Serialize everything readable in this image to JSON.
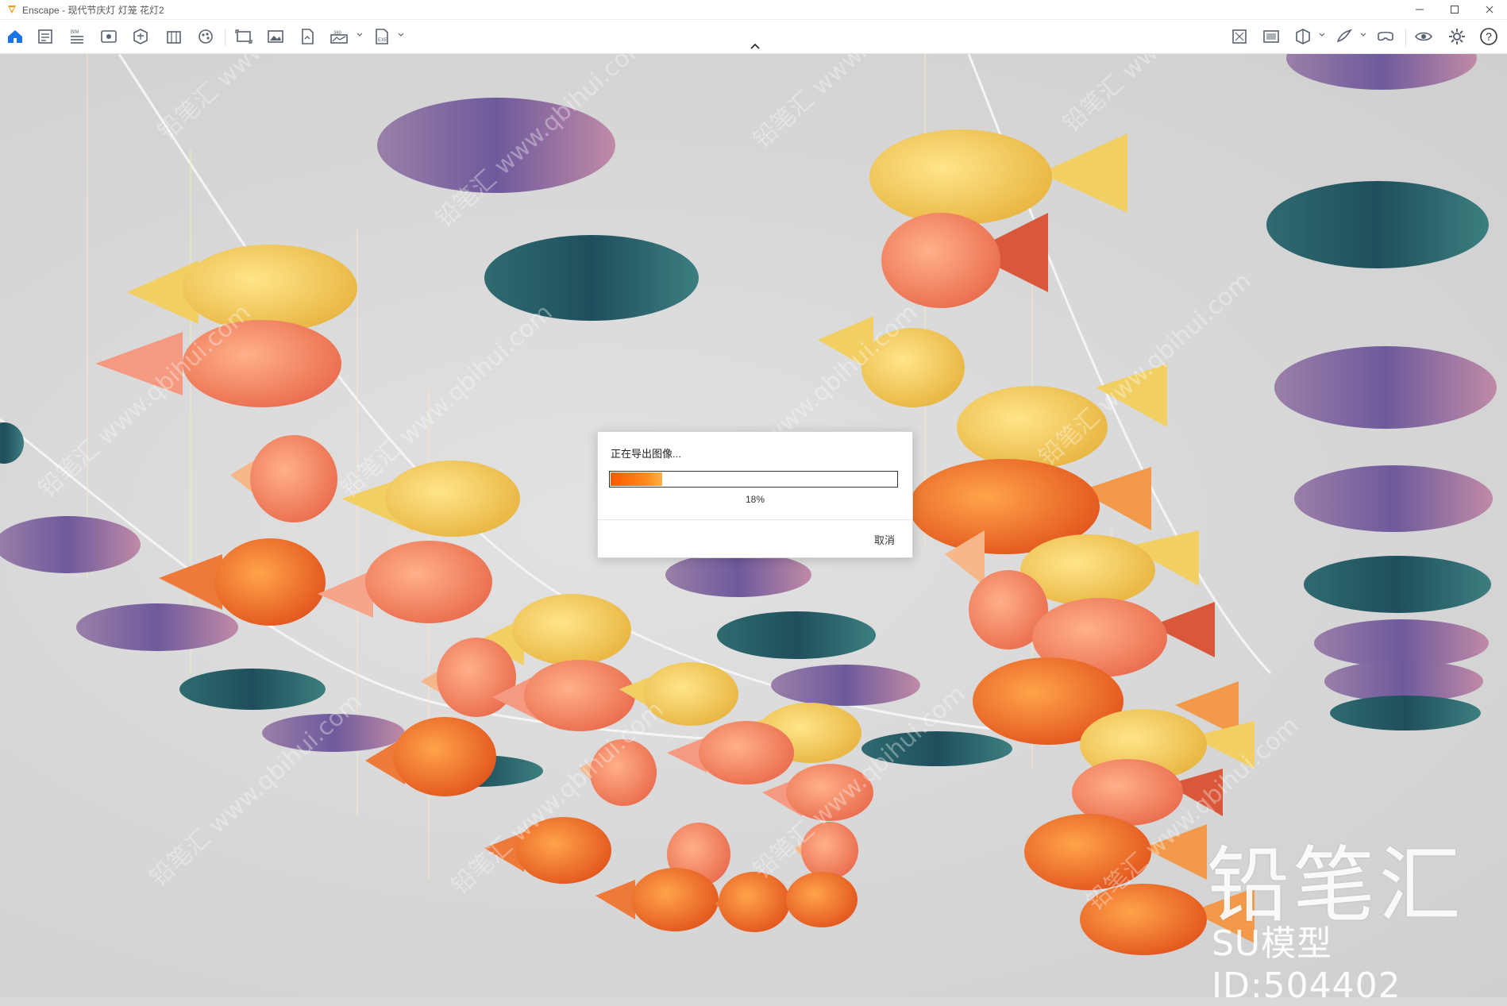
{
  "window": {
    "app_name": "Enscape",
    "title": "Enscape - 现代节庆灯 灯笼 花灯2",
    "controls": [
      "minimize-icon",
      "maximize-icon",
      "close-icon"
    ]
  },
  "toolbar": {
    "left_icons": [
      "home-icon",
      "document-icon",
      "bim-icon",
      "views-icon",
      "asset-library-icon",
      "building-icon",
      "materials-icon",
      "batch-render-icon",
      "screenshot-icon",
      "export-image-icon",
      "panorama-icon",
      "exe-export-icon"
    ],
    "bim_label": "BIM",
    "panorama_label": "360",
    "exe_label": "EXE",
    "right_icons": [
      "sync-selection-icon",
      "capture-icon",
      "section-icon",
      "draw-icon",
      "vr-headset-icon",
      "visibility-icon",
      "settings-icon",
      "help-icon"
    ],
    "help_label": "?"
  },
  "dialog": {
    "title": "正在导出图像...",
    "progress": 0.18,
    "progress_label": "18%",
    "cancel_label": "取消"
  },
  "watermark": {
    "brand": "铅笔汇",
    "model_id": "SU模型ID:504402",
    "diagonal_text": "铅笔汇 www.qbihui.com"
  },
  "colors": {
    "accent": "#ff6a00",
    "toolbar_icon": "#5a6270",
    "home_icon": "#1a73e8",
    "background": "#d9d9da"
  }
}
